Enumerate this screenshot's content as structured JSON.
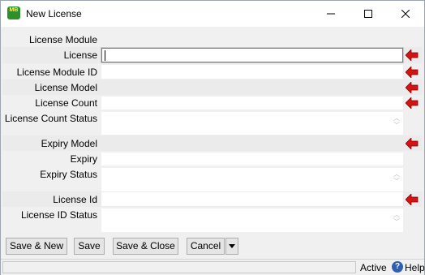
{
  "window": {
    "title": "New License",
    "app_icon_text": "MB"
  },
  "form": {
    "fields": [
      {
        "label": "License Module",
        "value": "",
        "required": false
      },
      {
        "label": "License",
        "value": "",
        "required": true
      },
      {
        "label": "License Module ID",
        "value": "",
        "required": true
      },
      {
        "label": "License Model",
        "value": "",
        "required": true
      },
      {
        "label": "License Count",
        "value": "",
        "required": true
      },
      {
        "label": "License Count Status",
        "value": "",
        "required": false
      },
      {
        "label": "Expiry Model",
        "value": "",
        "required": true
      },
      {
        "label": "Expiry",
        "value": "",
        "required": false
      },
      {
        "label": "Expiry Status",
        "value": "",
        "required": false
      },
      {
        "label": "License Id",
        "value": "",
        "required": true
      },
      {
        "label": "License ID Status",
        "value": "",
        "required": false
      }
    ]
  },
  "buttons": {
    "save_new": "Save & New",
    "save": "Save",
    "save_close": "Save & Close",
    "cancel": "Cancel"
  },
  "statusbar": {
    "state": "Active",
    "help": "Help"
  },
  "colors": {
    "required_arrow": "#d41414",
    "app_icon": "#2f8f2a",
    "help_icon": "#2f5fb3"
  }
}
